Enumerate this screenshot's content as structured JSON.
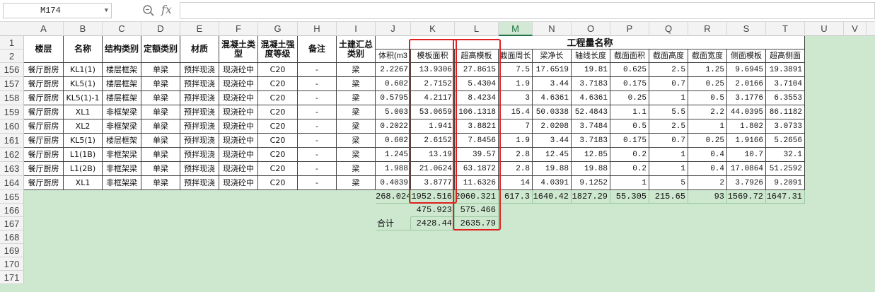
{
  "formula_bar": {
    "name_box": "M174",
    "formula": ""
  },
  "columns": [
    "A",
    "B",
    "C",
    "D",
    "E",
    "F",
    "G",
    "H",
    "I",
    "J",
    "K",
    "L",
    "M",
    "N",
    "O",
    "P",
    "Q",
    "R",
    "S",
    "T",
    "U",
    "V"
  ],
  "selected_column": "M",
  "row_numbers": [
    "1",
    "2",
    "156",
    "157",
    "158",
    "159",
    "160",
    "161",
    "162",
    "163",
    "164",
    "165",
    "166",
    "167",
    "168",
    "169",
    "170",
    "171"
  ],
  "header": {
    "A": "楼层",
    "B": "名称",
    "C": "结构类别",
    "D": "定额类别",
    "E": "材质",
    "F": "混凝土类型",
    "G": "混凝土强度等级",
    "H": "备注",
    "I": "土建汇总类别",
    "group": "工程量名称",
    "J": "体积(m3",
    "K": "模板面积",
    "L": "超高模板",
    "M": "截面周长",
    "N": "梁净长",
    "O": "轴线长度",
    "P": "截面面积",
    "Q": "截面高度",
    "R": "截面宽度",
    "S": "侧面模板",
    "T": "超高侧面"
  },
  "rows": [
    [
      "餐厅厨房",
      "KL1(1)",
      "楼层框架",
      "单梁",
      "预拌现浇",
      "现浇砼中",
      "C20",
      "-",
      "梁",
      "2.2267",
      "13.9306",
      "27.8615",
      "7.5",
      "17.6519",
      "19.81",
      "0.625",
      "2.5",
      "1.25",
      "9.6945",
      "19.3891"
    ],
    [
      "餐厅厨房",
      "KL5(1)",
      "楼层框架",
      "单梁",
      "预拌现浇",
      "现浇砼中",
      "C20",
      "-",
      "梁",
      "0.602",
      "2.7152",
      "5.4304",
      "1.9",
      "3.44",
      "3.7183",
      "0.175",
      "0.7",
      "0.25",
      "2.0166",
      "3.7104"
    ],
    [
      "餐厅厨房",
      "KL5(1)-1",
      "楼层框架",
      "单梁",
      "预拌现浇",
      "现浇砼中",
      "C20",
      "-",
      "梁",
      "0.5795",
      "4.2117",
      "8.4234",
      "3",
      "4.6361",
      "4.6361",
      "0.25",
      "1",
      "0.5",
      "3.1776",
      "6.3553"
    ],
    [
      "餐厅厨房",
      "XL1",
      "非框架梁",
      "单梁",
      "预拌现浇",
      "现浇砼中",
      "C20",
      "-",
      "梁",
      "5.003",
      "53.0659",
      "106.1318",
      "15.4",
      "50.0338",
      "52.4843",
      "1.1",
      "5.5",
      "2.2",
      "44.0395",
      "86.1182"
    ],
    [
      "餐厅厨房",
      "XL2",
      "非框架梁",
      "单梁",
      "预拌现浇",
      "现浇砼中",
      "C20",
      "-",
      "梁",
      "0.2022",
      "1.941",
      "3.8821",
      "7",
      "2.0208",
      "3.7484",
      "0.5",
      "2.5",
      "1",
      "1.802",
      "3.0733"
    ],
    [
      "餐厅厨房",
      "KL5(1)",
      "楼层框架",
      "单梁",
      "预拌现浇",
      "现浇砼中",
      "C20",
      "-",
      "梁",
      "0.602",
      "2.6152",
      "7.8456",
      "1.9",
      "3.44",
      "3.7183",
      "0.175",
      "0.7",
      "0.25",
      "1.9166",
      "5.2656"
    ],
    [
      "餐厅厨房",
      "L1(1B)",
      "非框架梁",
      "单梁",
      "预拌现浇",
      "现浇砼中",
      "C20",
      "-",
      "梁",
      "1.245",
      "13.19",
      "39.57",
      "2.8",
      "12.45",
      "12.85",
      "0.2",
      "1",
      "0.4",
      "10.7",
      "32.1"
    ],
    [
      "餐厅厨房",
      "L1(2B)",
      "非框架梁",
      "单梁",
      "预拌现浇",
      "现浇砼中",
      "C20",
      "-",
      "梁",
      "1.988",
      "21.0624",
      "63.1872",
      "2.8",
      "19.88",
      "19.88",
      "0.2",
      "1",
      "0.4",
      "17.0864",
      "51.2592"
    ],
    [
      "餐厅厨房",
      "XL1",
      "非框架梁",
      "单梁",
      "预拌现浇",
      "现浇砼中",
      "C20",
      "-",
      "梁",
      "0.4039",
      "3.8777",
      "11.6326",
      "14",
      "4.0391",
      "9.1252",
      "1",
      "5",
      "2",
      "3.7926",
      "9.2091"
    ]
  ],
  "totals": {
    "J": "268.024",
    "K": "1952.516",
    "L": "2060.321",
    "M": "617.3",
    "N": "1640.42",
    "O": "1827.29",
    "P": "55.305",
    "Q": "215.65",
    "R": "93",
    "S": "1569.72",
    "T": "1647.31"
  },
  "row166": {
    "K": "475.923",
    "L": "575.466"
  },
  "row167": {
    "J": "合计",
    "K": "2428.44",
    "L": "2635.79"
  },
  "colors": {
    "sheet_bg": "#cde8cf",
    "accent": "#217346",
    "highlight_box": "#e02020"
  }
}
